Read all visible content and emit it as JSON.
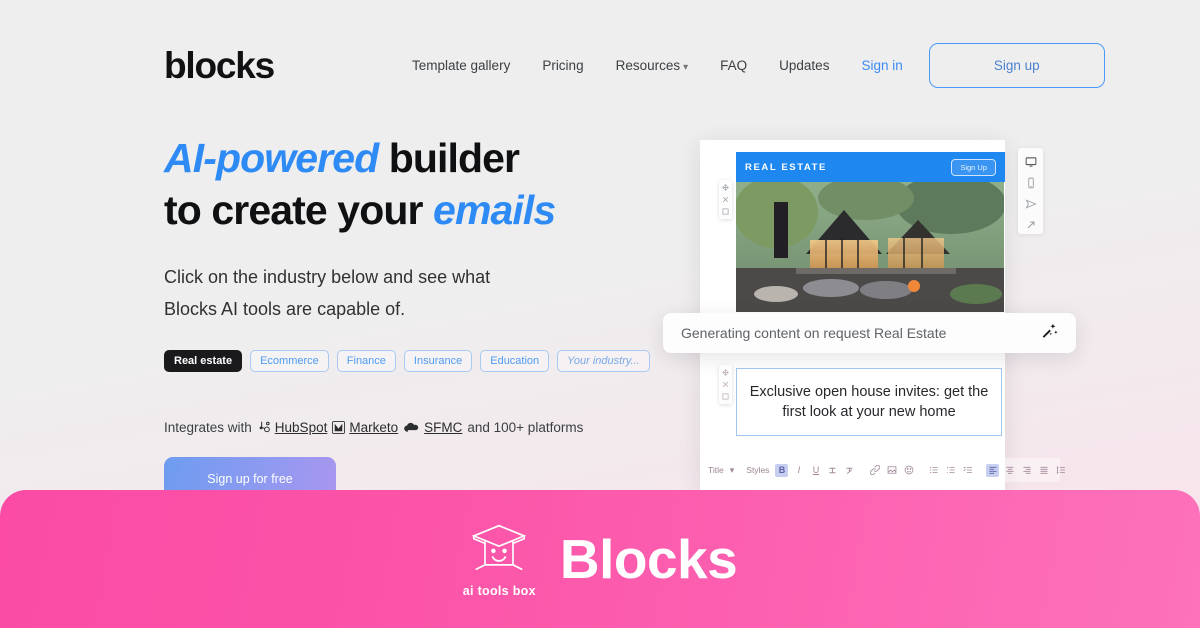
{
  "header": {
    "logo": "blocks",
    "nav": [
      {
        "label": "Template gallery",
        "type": "link"
      },
      {
        "label": "Pricing",
        "type": "link"
      },
      {
        "label": "Resources",
        "type": "dropdown",
        "chevron": "chevron-down-icon"
      },
      {
        "label": "FAQ",
        "type": "link"
      },
      {
        "label": "Updates",
        "type": "link"
      },
      {
        "label": "Sign in",
        "type": "link-accent"
      }
    ],
    "signup_label": "Sign up"
  },
  "hero": {
    "headline_line1_accent": "AI-powered",
    "headline_line1_rest": " builder",
    "headline_line2_rest": "to create your ",
    "headline_line2_accent": "emails",
    "subcopy_line1": "Click on the industry below and see what",
    "subcopy_line2": "Blocks AI tools are capable of.",
    "chips": [
      {
        "label": "Real estate",
        "active": true
      },
      {
        "label": "Ecommerce",
        "active": false
      },
      {
        "label": "Finance",
        "active": false
      },
      {
        "label": "Insurance",
        "active": false
      },
      {
        "label": "Education",
        "active": false
      },
      {
        "label": "Your industry...",
        "active": false,
        "ghost": true
      }
    ],
    "integrates_prefix": "Integrates with",
    "integrations": [
      {
        "name": "HubSpot",
        "icon": "hubspot-icon"
      },
      {
        "name": "Marketo",
        "icon": "marketo-icon"
      },
      {
        "name": "SFMC",
        "icon": "sfmc-cloud-icon"
      }
    ],
    "integrates_suffix": "and 100+ platforms",
    "cta_label": "Sign up for free"
  },
  "editor": {
    "email_brand": "REAL ESTATE",
    "email_cta": "Sign Up",
    "generating_text": "Generating content on request Real Estate",
    "generating_icon": "magic-wand-sparkle-icon",
    "body_text": "Exclusive open house invites: get the first look at your new home",
    "format_bar": {
      "title_label": "Title",
      "styles_label": "Styles",
      "tools": [
        "bold-icon",
        "italic-icon",
        "underline-icon",
        "strikethrough-icon",
        "clear-format-icon",
        "link-icon",
        "image-icon",
        "emoji-icon",
        "bullet-list-icon",
        "numbered-list-icon",
        "checklist-icon",
        "align-left-icon",
        "align-center-icon",
        "align-right-icon",
        "align-justify-icon",
        "line-height-icon"
      ]
    },
    "device_bar": [
      "desktop-icon",
      "mobile-icon",
      "send-test-icon",
      "expand-icon"
    ],
    "block_handles": [
      "move-icon",
      "delete-icon",
      "duplicate-icon"
    ]
  },
  "banner": {
    "title": "Blocks",
    "logo_caption": "ai tools box",
    "logo_icon": "ai-toolbox-smiley-box-icon",
    "color": "#fb4ba5"
  },
  "colors": {
    "accent_blue": "#2e8bf5",
    "link_blue": "#3b8bf5",
    "banner_pink": "#fb4ba5",
    "chip_active_bg": "#1a1a1c",
    "email_header_blue": "#1e87f0"
  }
}
